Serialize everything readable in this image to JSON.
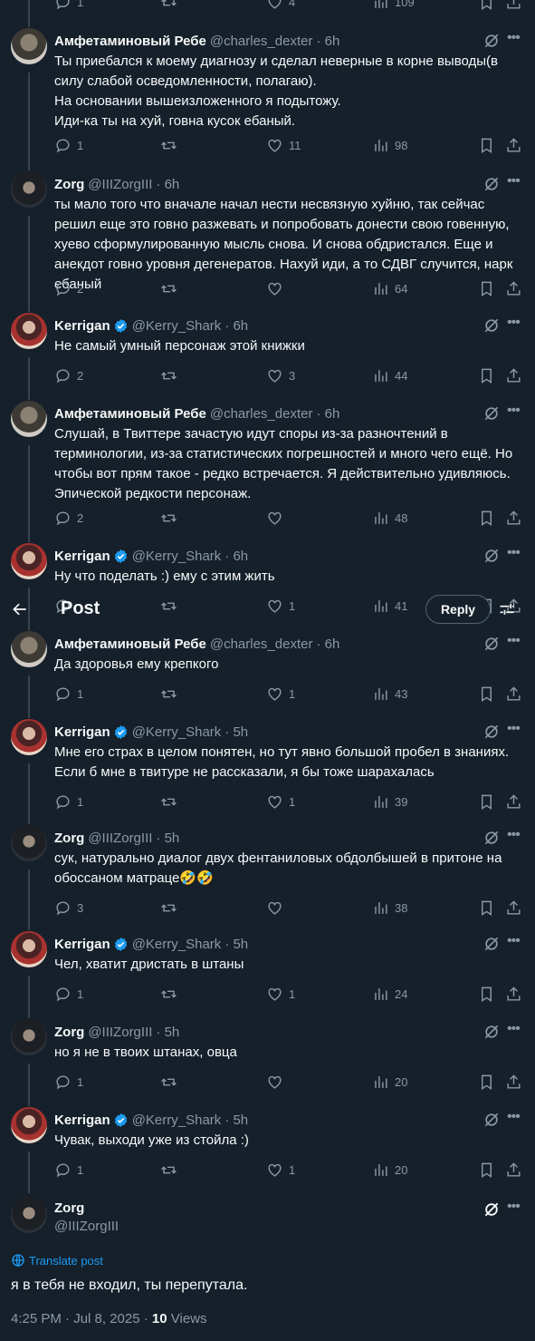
{
  "header": {
    "back_icon": "arrow-left-icon",
    "title": "Post",
    "reply_label": "Reply",
    "tune_icon": "sliders-icon"
  },
  "top_partial": {
    "replies": "1",
    "likes": "4",
    "views": "109"
  },
  "tweets": [
    {
      "name": "Амфетаминовый Ребе",
      "handle": "@charles_dexter",
      "time": "· 6h",
      "verified": false,
      "lines": [
        "Ты приебался к моему диагнозу и сделал неверные в корне выводы(в силу слабой осведомленности, полагаю).",
        "На основании вышеизложенного я подытожу.",
        "Иди-ка ты на хуй, говна кусок ебаный."
      ],
      "replies": "1",
      "reposts": "",
      "likes": "11",
      "views": "98"
    },
    {
      "name": "Zorg",
      "handle": "@IIIZorgIII",
      "time": "· 6h",
      "verified": false,
      "lines": [
        "ты мало того что вначале начал нести несвязную хуйню, так сейчас решил еще это говно разжевать и попробовать донести свою говенную, хуево сформулированную мысль снова. И снова обдристался. Еще и анекдот говно уровня дегенератов. Нахуй иди, а то СДВГ случится, нарк ебаный"
      ],
      "replies": "2",
      "reposts": "",
      "likes": "",
      "views": "64"
    },
    {
      "name": "Kerrigan",
      "handle": "@Kerry_Shark",
      "time": "· 6h",
      "verified": true,
      "lines": [
        "Не самый умный персонаж этой книжки"
      ],
      "replies": "2",
      "reposts": "",
      "likes": "3",
      "views": "44"
    },
    {
      "name": "Амфетаминовый Ребе",
      "handle": "@charles_dexter",
      "time": "· 6h",
      "verified": false,
      "lines": [
        "Слушай, в Твиттере зачастую идут споры из-за разночтений в терминологии, из-за статистических погрешностей и много чего ещё. Но чтобы вот прям такое - редко встречается. Я действительно удивляюсь. Эпической редкости персонаж."
      ],
      "replies": "2",
      "reposts": "",
      "likes": "",
      "views": "48"
    },
    {
      "name": "Kerrigan",
      "handle": "@Kerry_Shark",
      "time": "· 6h",
      "verified": true,
      "lines": [
        "Ну что поделать :) ему с этим жить"
      ],
      "replies": "",
      "reposts": "",
      "likes": "1",
      "views": "41"
    },
    {
      "name": "Амфетаминовый Ребе",
      "handle": "@charles_dexter",
      "time": "· 6h",
      "verified": false,
      "lines": [
        "Да здоровья ему крепкого"
      ],
      "replies": "1",
      "reposts": "",
      "likes": "1",
      "views": "43"
    },
    {
      "name": "Kerrigan",
      "handle": "@Kerry_Shark",
      "time": "· 5h",
      "verified": true,
      "lines": [
        "Мне его страх в целом понятен, но тут явно большой пробел в знаниях. Если б мне в твитуре не рассказали, я бы тоже шарахалась"
      ],
      "replies": "1",
      "reposts": "",
      "likes": "1",
      "views": "39"
    },
    {
      "name": "Zorg",
      "handle": "@IIIZorgIII",
      "time": "· 5h",
      "verified": false,
      "lines": [
        "сук, натурально диалог двух фентаниловых обдолбышей в притоне на обоссаном матраце🤣🤣"
      ],
      "replies": "3",
      "reposts": "",
      "likes": "",
      "views": "38"
    },
    {
      "name": "Kerrigan",
      "handle": "@Kerry_Shark",
      "time": "· 5h",
      "verified": true,
      "lines": [
        "Чел, хватит дристать в штаны"
      ],
      "replies": "1",
      "reposts": "",
      "likes": "1",
      "views": "24"
    },
    {
      "name": "Zorg",
      "handle": "@IIIZorgIII",
      "time": "· 5h",
      "verified": false,
      "lines": [
        "но я не в твоих штанах, овца"
      ],
      "replies": "1",
      "reposts": "",
      "likes": "",
      "views": "20"
    },
    {
      "name": "Kerrigan",
      "handle": "@Kerry_Shark",
      "time": "· 5h",
      "verified": true,
      "lines": [
        "Чувак, выходи уже из стойла :)"
      ],
      "replies": "1",
      "reposts": "",
      "likes": "1",
      "views": "20"
    }
  ],
  "main": {
    "name": "Zorg",
    "handle": "@IIIZorgIII",
    "translate": "Translate post",
    "text": "я в тебя не входил, ты перепутала.",
    "time": "4:25 PM · Jul 8, 2025 · ",
    "views_count": "10",
    "views_label": " Views"
  },
  "colors": {
    "bg": "#15202b",
    "accent": "#1d9bf0",
    "muted": "#8b98a5",
    "line": "#38444d"
  }
}
